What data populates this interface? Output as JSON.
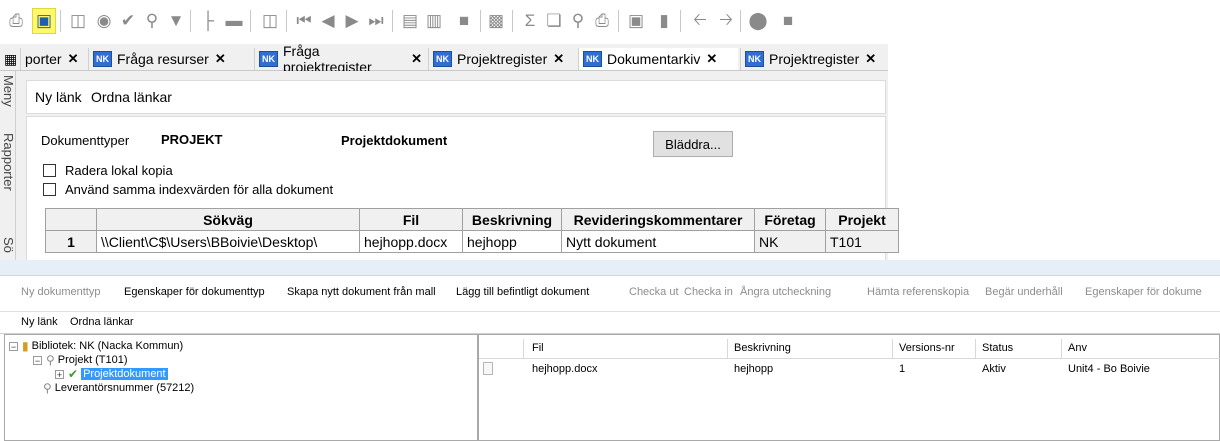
{
  "toolbar": {
    "icons": [
      "print-icon",
      "save-icon",
      "open-folder-icon",
      "binoculars-icon",
      "check-icon",
      "pin-icon",
      "filter-icon",
      "tree-icon",
      "square-icon",
      "help-icon",
      "first-icon",
      "prev-icon",
      "next-icon",
      "last-icon",
      "columns-icon",
      "split-icon",
      "block-icon",
      "chart-icon",
      "sum-icon",
      "copy-icon",
      "zoom-icon",
      "print-preview-icon",
      "window-icon",
      "library-icon",
      "back-icon",
      "forward-icon",
      "stop-icon",
      "stop2-icon"
    ]
  },
  "tabs": [
    {
      "label": "porter"
    },
    {
      "label": "Fråga resurser"
    },
    {
      "label": "Fråga projektregister"
    },
    {
      "label": "Projektregister"
    },
    {
      "label": "Dokumentarkiv"
    },
    {
      "label": "Projektregister"
    }
  ],
  "tab_badge": "NK",
  "tab_close": "✕",
  "side": {
    "menu": "Meny",
    "rapporter": "Rapporter",
    "sok": "Sö"
  },
  "top_links": {
    "new_link": "Ny länk",
    "arrange": "Ordna länkar"
  },
  "doc": {
    "types_label": "Dokumenttyper",
    "types_value": "PROJEKT",
    "category": "Projektdokument",
    "browse": "Bläddra...",
    "delete_local": "Radera lokal kopia",
    "same_index": "Använd samma indexvärden för alla dokument"
  },
  "grid": {
    "headers": [
      "Sökväg",
      "Fil",
      "Beskrivning",
      "Revideringskommentarer",
      "Företag",
      "Projekt"
    ],
    "rows": [
      {
        "num": "1",
        "path": "\\\\Client\\C$\\Users\\BBoivie\\Desktop\\",
        "file": "hejhopp.docx",
        "desc": "hejhopp",
        "comment": "Nytt dokument",
        "company": "NK",
        "project": "T101"
      }
    ]
  },
  "actions": [
    {
      "label": "Ny dokumenttyp",
      "enabled": false
    },
    {
      "label": "Egenskaper för dokumenttyp",
      "enabled": true
    },
    {
      "label": "Skapa nytt dokument från mall",
      "enabled": true
    },
    {
      "label": "Lägg till befintligt dokument",
      "enabled": true
    },
    {
      "label": "Checka ut",
      "enabled": false
    },
    {
      "label": "Checka in",
      "enabled": false
    },
    {
      "label": "Ångra utcheckning",
      "enabled": false
    },
    {
      "label": "Hämta referenskopia",
      "enabled": false
    },
    {
      "label": "Begär underhåll",
      "enabled": false
    },
    {
      "label": "Egenskaper för dokume",
      "enabled": false
    }
  ],
  "bottom_links": {
    "new_link": "Ny länk",
    "arrange": "Ordna länkar"
  },
  "tree": {
    "library": "Bibliotek: NK (Nacka Kommun)",
    "project": "Projekt (T101)",
    "selected": "Projektdokument",
    "supplier": "Leverantörsnummer (57212)"
  },
  "filelist": {
    "headers": [
      "Fil",
      "Beskrivning",
      "Versions-nr",
      "Status",
      "Anv"
    ],
    "rows": [
      {
        "file": "hejhopp.docx",
        "desc": "hejhopp",
        "version": "1",
        "status": "Aktiv",
        "user": "Unit4 - Bo Boivie"
      }
    ]
  },
  "colors": {
    "highlight": "#fff86a",
    "accent": "#2f6fd1",
    "selection": "#3399ff"
  }
}
